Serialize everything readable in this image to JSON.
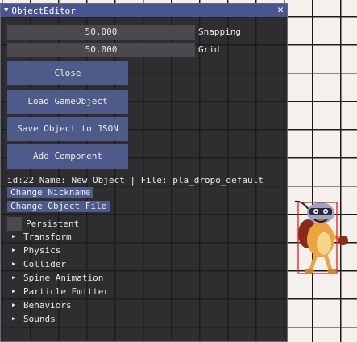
{
  "window": {
    "title": "ObjectEditor",
    "collapse_icon": "triangle-down-icon",
    "close_icon": "close-icon"
  },
  "fields": [
    {
      "value": "50.000",
      "label": "Snapping"
    },
    {
      "value": "50.000",
      "label": "Grid"
    }
  ],
  "buttons": {
    "close": "Close",
    "load": "Load GameObject",
    "save": "Save Object to JSON",
    "add": "Add Component"
  },
  "info_line": "id:22 Name: New Object | File: pla_dropo_default",
  "change_nickname": "Change Nickname",
  "change_file": "Change Object File",
  "persistent_label": "Persistent",
  "components": [
    "Transform",
    "Physics",
    "Collider",
    "Spine Animation",
    "Particle Emitter",
    "Behaviors",
    "Sounds"
  ],
  "colors": {
    "title_bar": "#4a5490",
    "button": "#4e5a8a",
    "field": "#4a4a4e",
    "selection_box": "#e02020"
  }
}
